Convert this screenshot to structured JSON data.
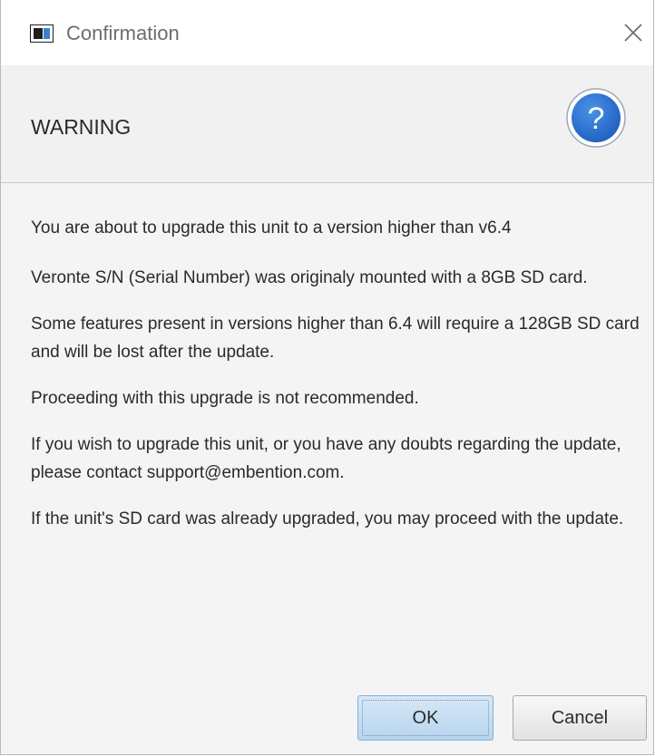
{
  "window": {
    "title": "Confirmation"
  },
  "header": {
    "text": "WARNING",
    "icon": "question-mark-icon",
    "icon_glyph": "?",
    "icon_color": "#2f78d6"
  },
  "message": {
    "paragraphs": [
      "You are about to upgrade this unit to a version higher than v6.4",
      "Veronte S/N (Serial Number) was originaly mounted with a 8GB SD card.",
      "Some features present in versions higher than 6.4 will require a 128GB SD card and will be lost after the update.",
      "Proceeding with this upgrade is not recommended.",
      "If you wish to upgrade this unit, or you have any doubts regarding the update, please contact support@embention.com.",
      "If the unit's SD card was already upgraded, you may proceed with the update."
    ]
  },
  "buttons": {
    "ok_label": "OK",
    "cancel_label": "Cancel"
  },
  "colors": {
    "ok_button_bg": "#c6e0f5",
    "window_bg": "#f4f4f4"
  }
}
